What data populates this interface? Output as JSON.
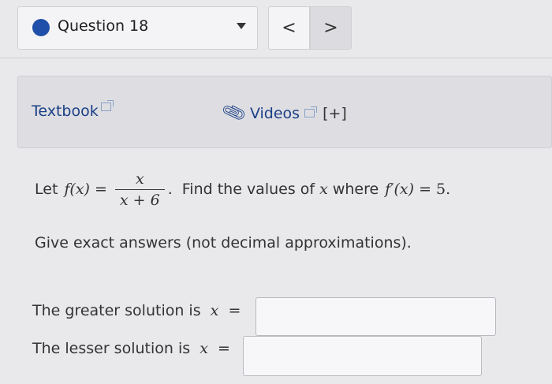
{
  "question_bar": {
    "label": "Question 18",
    "prev_symbol": "<",
    "next_symbol": ">"
  },
  "resources": {
    "textbook_label": "Textbook",
    "videos_label": "Videos",
    "expand_label": "[+]"
  },
  "problem": {
    "intro": "Let",
    "f_of_x": "f(x)",
    "equals": "=",
    "numerator": "x",
    "denominator": "x + 6",
    "period": ".",
    "find_text": "Find the values of",
    "var_x": "x",
    "where_text": "where",
    "fprime": "f′(x)",
    "equals_five": "= 5.",
    "instructions": "Give exact answers (not decimal approximations)."
  },
  "answers": {
    "greater_label": "The greater solution is",
    "lesser_label": "The lesser solution is",
    "var_x": "x",
    "equals": "=",
    "greater_value": "",
    "lesser_value": ""
  },
  "colors": {
    "accent": "#1f4fa8",
    "link": "#1b3f86",
    "background": "#e9e9ec"
  },
  "icons": {
    "status_dot": "filled-circle",
    "dropdown": "caret-down",
    "external_link": "external-link",
    "paperclip": "paperclip"
  }
}
